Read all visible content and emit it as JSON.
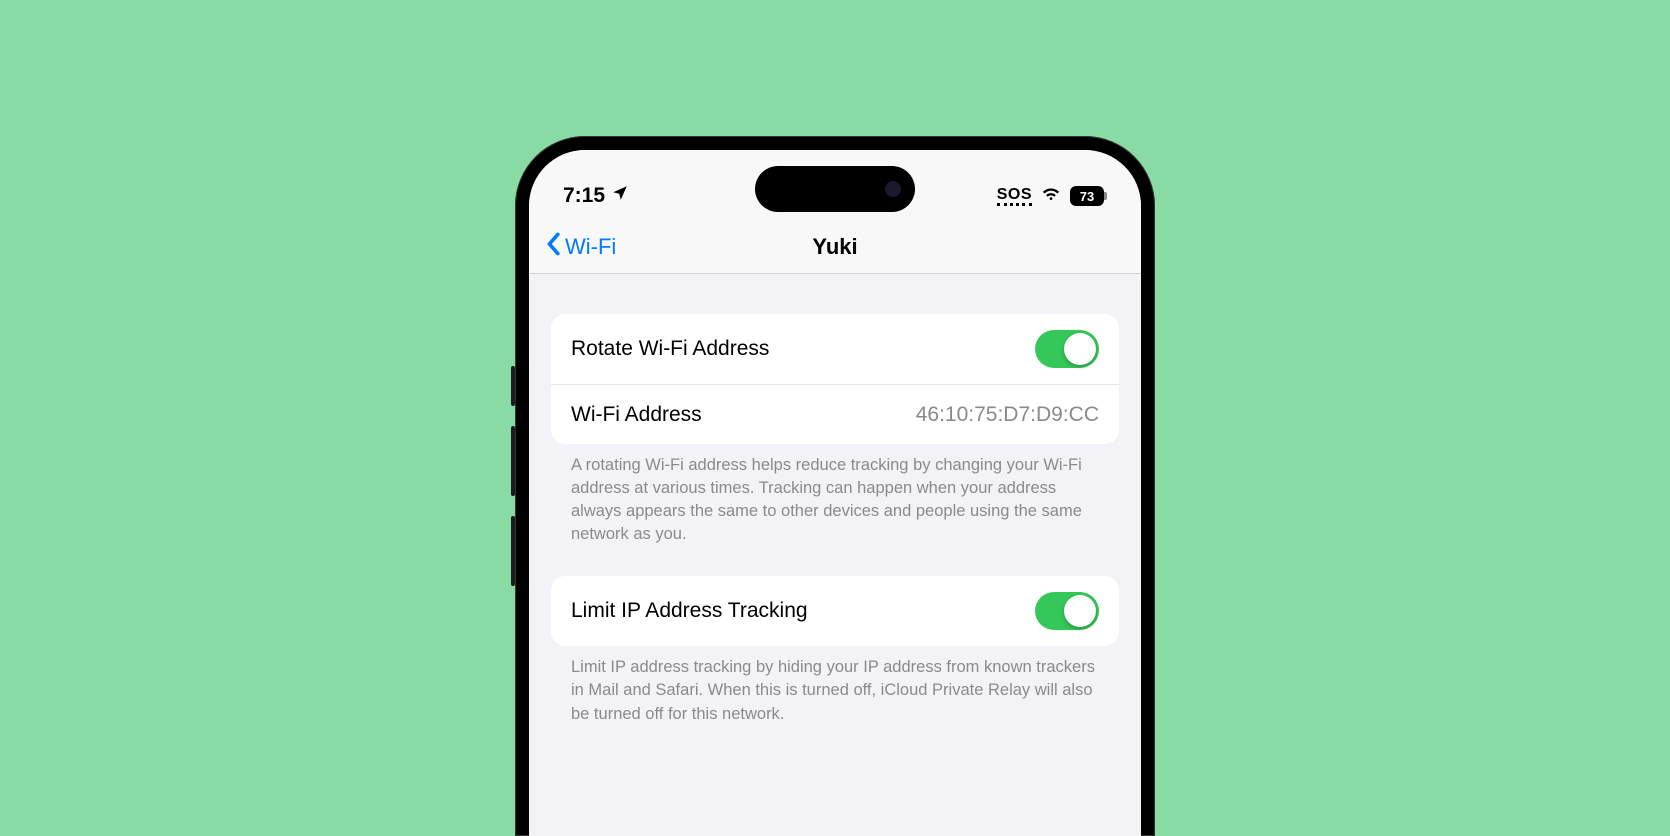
{
  "status": {
    "time": "7:15",
    "sos": "SOS",
    "battery": "73"
  },
  "nav": {
    "back_label": "Wi-Fi",
    "title": "Yuki"
  },
  "group1": {
    "rotate_label": "Rotate Wi-Fi Address",
    "rotate_on": true,
    "addr_label": "Wi-Fi Address",
    "addr_value": "46:10:75:D7:D9:CC",
    "footer": "A rotating Wi-Fi address helps reduce tracking by changing your Wi-Fi address at various times. Tracking can happen when your address always appears the same to other devices and people using the same network as you."
  },
  "group2": {
    "limit_label": "Limit IP Address Tracking",
    "limit_on": true,
    "footer": "Limit IP address tracking by hiding your IP address from known trackers in Mail and Safari. When this is turned off, iCloud Private Relay will also be turned off for this network."
  }
}
